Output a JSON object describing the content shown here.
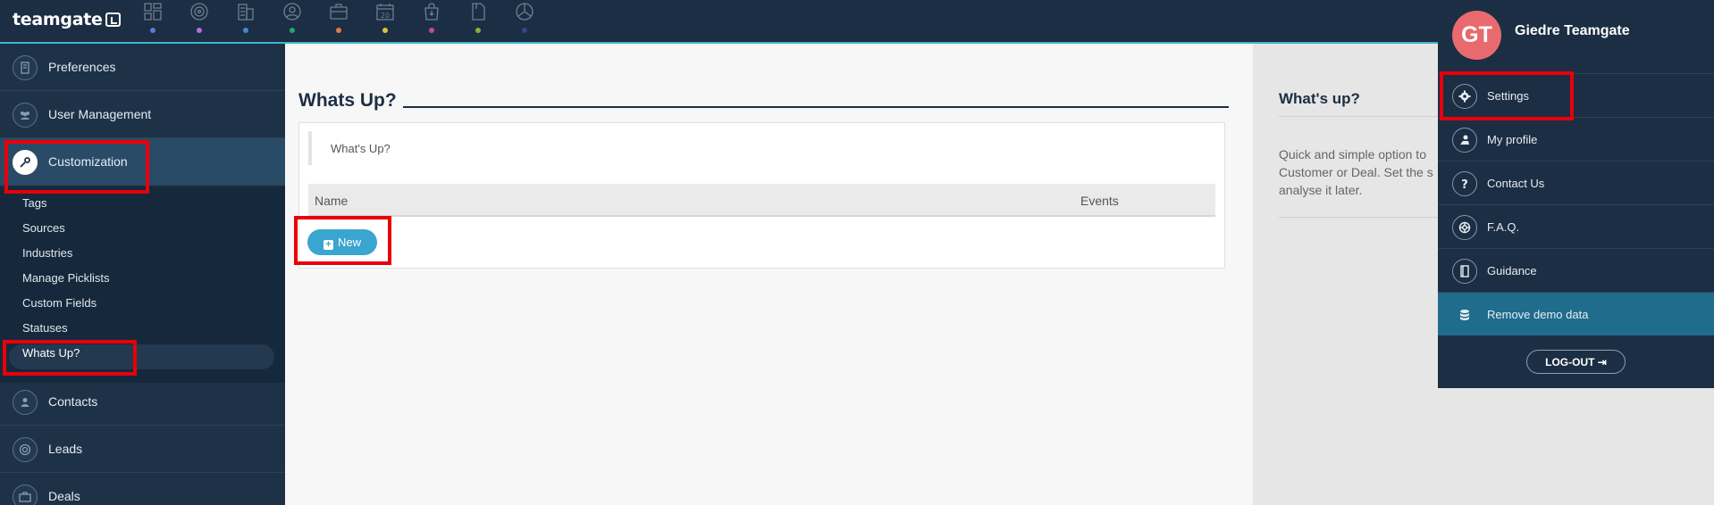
{
  "app": {
    "logo": "teamgate"
  },
  "topnav": {
    "icons": [
      {
        "name": "dashboard-icon",
        "color": "#5b7bd5"
      },
      {
        "name": "target-icon",
        "color": "#b46ee0"
      },
      {
        "name": "companies-icon",
        "color": "#4a86c9"
      },
      {
        "name": "contacts-nav-icon",
        "color": "#22a86b"
      },
      {
        "name": "briefcase-icon",
        "color": "#e27d3f"
      },
      {
        "name": "calendar-icon",
        "color": "#d9c43a",
        "text": "20"
      },
      {
        "name": "shopping-bag-icon",
        "color": "#c44a9a"
      },
      {
        "name": "document-icon",
        "color": "#7db63a"
      },
      {
        "name": "reports-icon",
        "color": "#2e4a87"
      }
    ]
  },
  "sidebar": {
    "items": [
      {
        "label": "Preferences"
      },
      {
        "label": "User Management"
      },
      {
        "label": "Customization"
      },
      {
        "label": "Contacts"
      },
      {
        "label": "Leads"
      },
      {
        "label": "Deals"
      }
    ],
    "sub_items": [
      "Tags",
      "Sources",
      "Industries",
      "Manage Picklists",
      "Custom Fields",
      "Statuses",
      "Whats Up?"
    ]
  },
  "main": {
    "title": "Whats Up?",
    "quote": "What's Up?",
    "columns": [
      "Name",
      "Events"
    ],
    "new_button": "New"
  },
  "info_panel": {
    "title": "What's up?",
    "text_lines": [
      "Quick and simple option to",
      "Customer or Deal. Set the s",
      "analyse it later."
    ]
  },
  "user_menu": {
    "initials": "GT",
    "name": "Giedre Teamgate",
    "items": [
      {
        "label": "Settings"
      },
      {
        "label": "My profile"
      },
      {
        "label": "Contact Us"
      },
      {
        "label": "F.A.Q."
      },
      {
        "label": "Guidance"
      },
      {
        "label": "Remove demo data"
      }
    ],
    "logout": "LOG-OUT"
  },
  "colors": {
    "accent": "#3aa5cf",
    "highlight": "#e8000b",
    "navy": "#1c2e43"
  }
}
